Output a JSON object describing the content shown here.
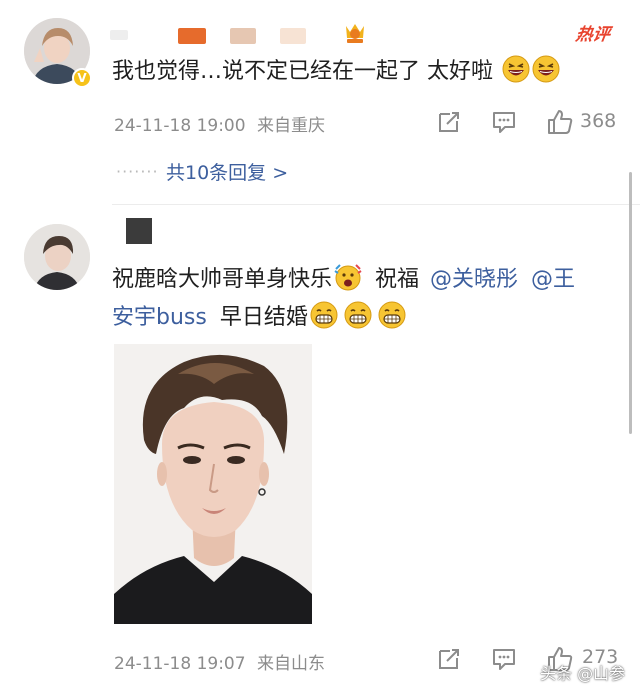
{
  "badges": {
    "hot": "热评"
  },
  "comment1": {
    "text": "我也觉得…说不定已经在一起了 太好啦",
    "emojis": [
      "laughing-face",
      "laughing-face"
    ],
    "timestamp": "24-11-18 19:00",
    "location": "来自重庆",
    "like_count": "368",
    "replies_link": "共10条回复 >",
    "replies_dots": "·······"
  },
  "comment2": {
    "text_part1": "祝鹿晗大帅哥单身快乐",
    "text_part2": "祝福",
    "mention1": "@关晓彤",
    "mention2_line1": "@王",
    "mention2_line2": "安宇buss",
    "text_part3": "早日结婚",
    "emojis": [
      "celebrating-face",
      "grinning-face",
      "grinning-face",
      "grinning-face"
    ],
    "timestamp": "24-11-18 19:07",
    "location": "来自山东",
    "like_count": "273"
  },
  "watermark": "头条 @山参",
  "colors": {
    "mention": "#3d5f9e",
    "meta": "#8c8c8c",
    "hot_badge": "#e8432e",
    "verified_badge": "#f6c21a"
  }
}
